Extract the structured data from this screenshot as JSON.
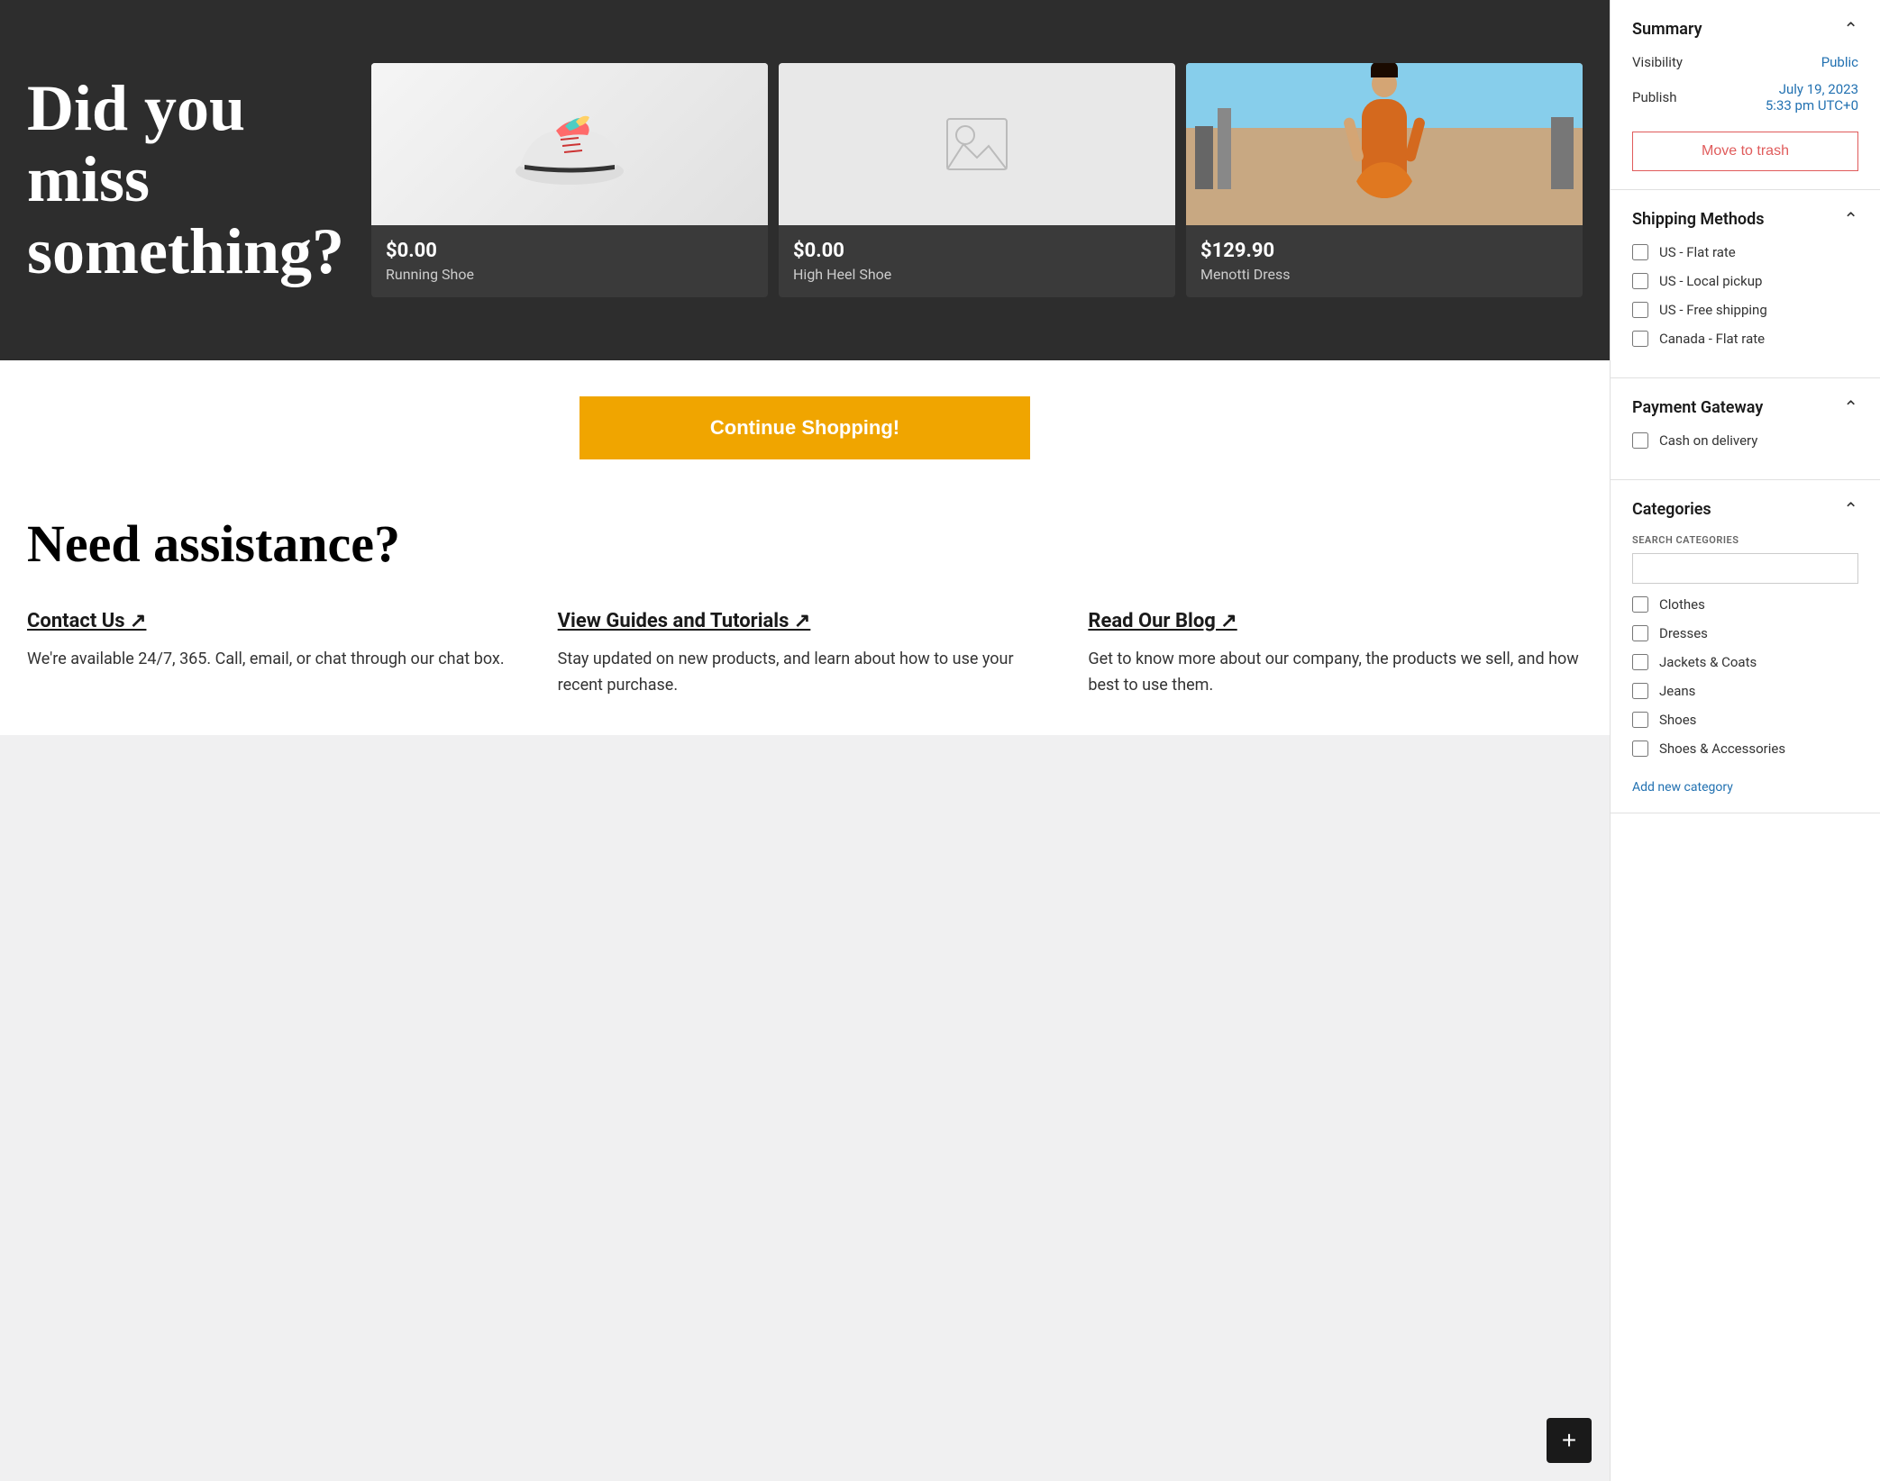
{
  "hero": {
    "title": "Did you miss something?",
    "products": [
      {
        "price": "$0.00",
        "name": "Running Shoe",
        "imageType": "shoe"
      },
      {
        "price": "$0.00",
        "name": "High Heel Shoe",
        "imageType": "placeholder"
      },
      {
        "price": "$129.90",
        "name": "Menotti Dress",
        "imageType": "dress"
      }
    ]
  },
  "continue_button": "Continue Shopping!",
  "assistance": {
    "title": "Need assistance?",
    "items": [
      {
        "link": "Contact Us ↗",
        "text": "We're available 24/7, 365. Call, email, or chat through our chat box."
      },
      {
        "link": "View Guides and Tutorials ↗",
        "text": "Stay updated on new products, and learn about how to use your recent purchase."
      },
      {
        "link": "Read Our Blog ↗",
        "text": "Get to know more about our company, the products we sell, and how best to use them."
      }
    ]
  },
  "sidebar": {
    "summary": {
      "title": "Summary",
      "visibility_label": "Visibility",
      "visibility_value": "Public",
      "publish_label": "Publish",
      "publish_date": "July 19, 2023",
      "publish_time": "5:33 pm UTC+0",
      "trash_button": "Move to trash"
    },
    "shipping": {
      "title": "Shipping Methods",
      "methods": [
        {
          "label": "US - Flat rate",
          "checked": false
        },
        {
          "label": "US - Local pickup",
          "checked": false
        },
        {
          "label": "US - Free shipping",
          "checked": false
        },
        {
          "label": "Canada - Flat rate",
          "checked": false
        }
      ]
    },
    "payment": {
      "title": "Payment Gateway",
      "gateways": [
        {
          "label": "Cash on delivery",
          "checked": false
        }
      ]
    },
    "categories": {
      "title": "Categories",
      "search_label": "SEARCH CATEGORIES",
      "search_placeholder": "",
      "items": [
        {
          "label": "Clothes",
          "checked": false
        },
        {
          "label": "Dresses",
          "checked": false
        },
        {
          "label": "Jackets & Coats",
          "checked": false
        },
        {
          "label": "Jeans",
          "checked": false
        },
        {
          "label": "Shoes",
          "checked": false
        },
        {
          "label": "Shoes & Accessories",
          "checked": false
        }
      ],
      "add_link": "Add new category"
    }
  },
  "fab_icon": "+"
}
